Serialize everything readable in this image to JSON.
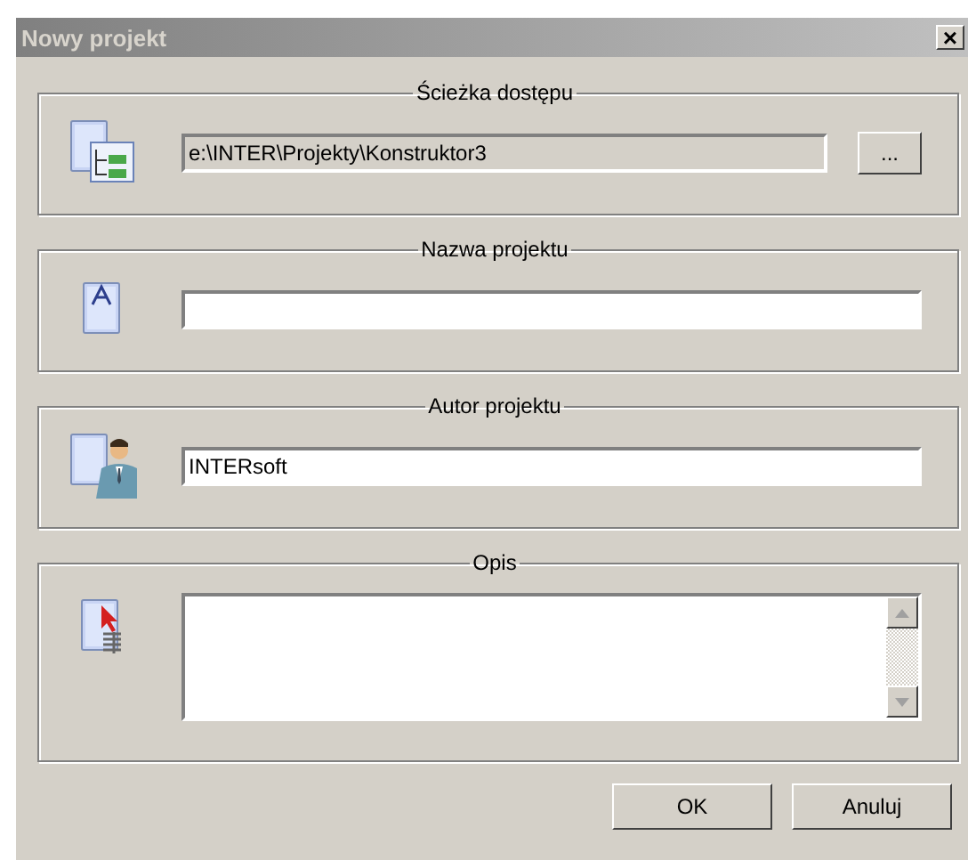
{
  "window": {
    "title": "Nowy projekt",
    "close": "×"
  },
  "sections": [
    {
      "legend": "Ścieżka dostępu",
      "kind": "path",
      "value": "e:\\INTER\\Projekty\\Konstruktor3",
      "button": "..."
    },
    {
      "legend": "Nazwa projektu",
      "kind": "text"
    },
    {
      "legend": "Autor projektu",
      "kind": "text",
      "value": "INTERsoft"
    },
    {
      "legend": "Opis",
      "kind": "memo"
    }
  ],
  "buttons": [
    "OK",
    "Anuluj"
  ]
}
